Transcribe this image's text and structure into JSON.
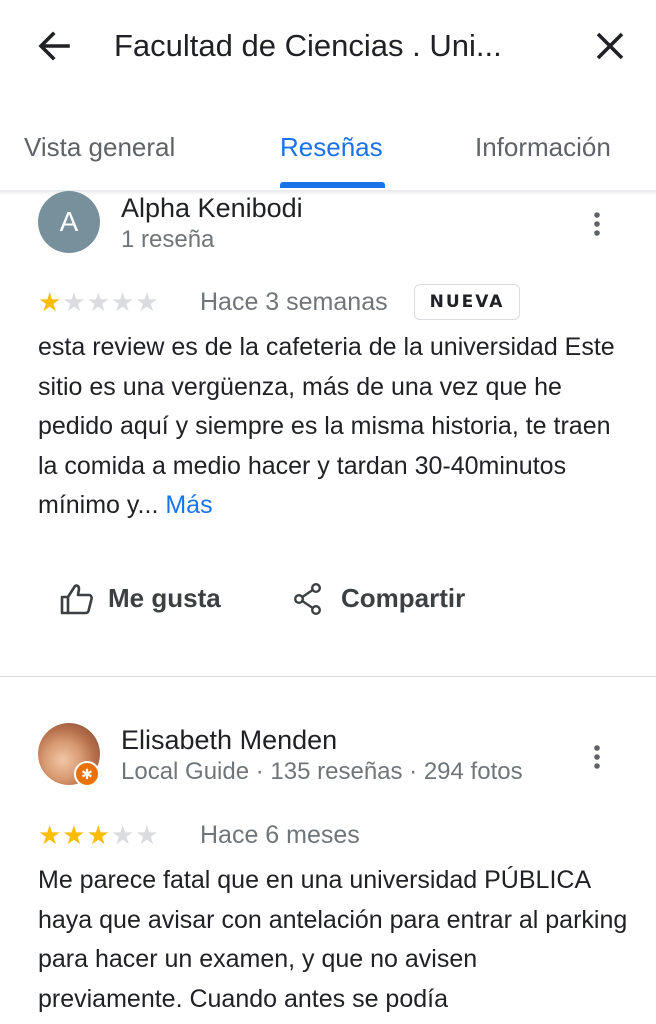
{
  "header": {
    "back_icon": "arrow-back-icon",
    "title": "Facultad de Ciencias . Uni...",
    "close_icon": "close-icon"
  },
  "tabs": [
    {
      "label": "Vista general",
      "active": false
    },
    {
      "label": "Reseñas",
      "active": true
    },
    {
      "label": "Información",
      "active": false
    }
  ],
  "colors": {
    "accent": "#1a73e8",
    "star": "#fbbc04",
    "badge_local_guide": "#e8710a"
  },
  "reviews": [
    {
      "avatar_letter": "A",
      "author": "Alpha Kenibodi",
      "meta": "1 reseña",
      "rating": 1,
      "max_rating": 5,
      "when": "Hace 3 semanas",
      "badge": "NUEVA",
      "text": "esta review es de la cafeteria de la universidad Este sitio es una vergüenza, más de una vez que he pedido aquí y siempre es la misma historia, te traen la comida a medio hacer y tardan 30-40minutos mínimo y...",
      "more_label": "Más",
      "actions": {
        "like_label": "Me gusta",
        "share_label": "Compartir"
      }
    },
    {
      "author": "Elisabeth Menden",
      "meta": "Local Guide · 135 reseñas · 294 fotos",
      "rating": 3,
      "max_rating": 5,
      "when": "Hace 6 meses",
      "text": "Me parece fatal que en una universidad PÚBLICA haya que avisar con antelación para entrar al parking para hacer un examen, y que no avisen previamente. Cuando antes se podía"
    }
  ]
}
